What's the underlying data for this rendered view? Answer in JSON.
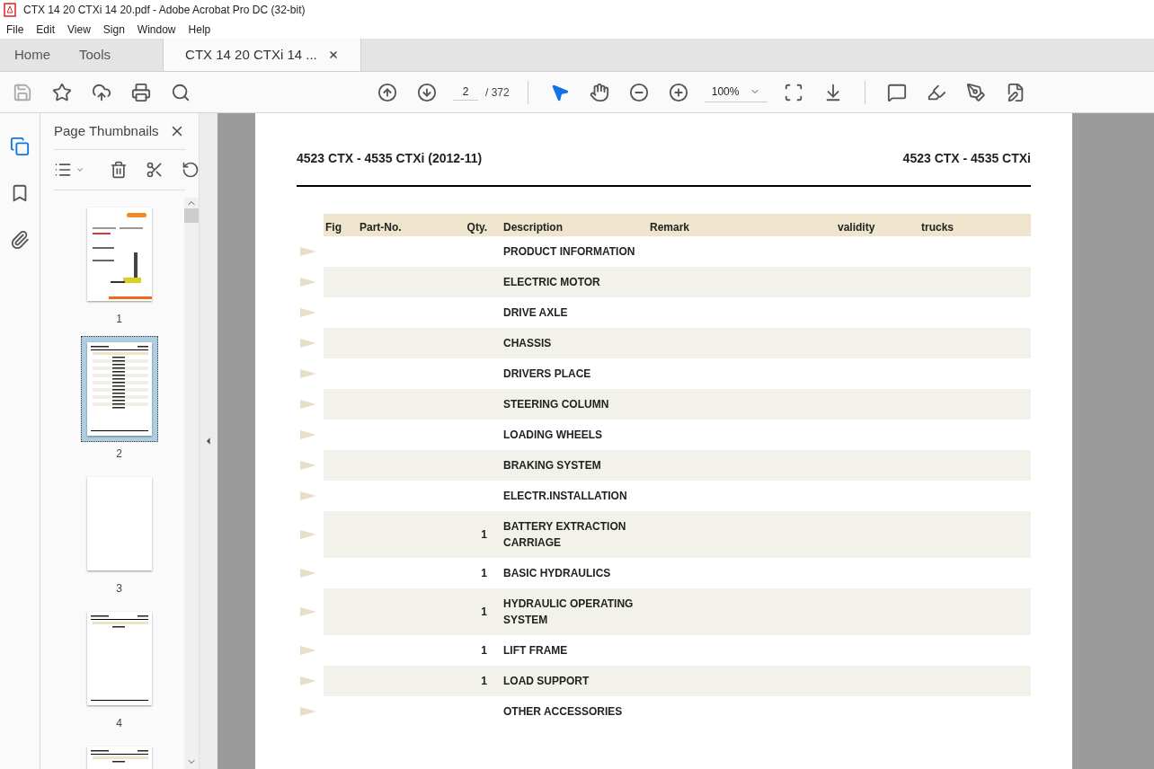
{
  "window": {
    "title": "CTX 14 20 CTXi 14 20.pdf - Adobe Acrobat Pro DC (32-bit)"
  },
  "menu": [
    "File",
    "Edit",
    "View",
    "Sign",
    "Window",
    "Help"
  ],
  "tabs": [
    {
      "label": "Home",
      "selected": false,
      "kind": "nav"
    },
    {
      "label": "Tools",
      "selected": false,
      "kind": "nav"
    },
    {
      "label": "CTX 14 20 CTXi 14 ...",
      "selected": true,
      "kind": "document"
    }
  ],
  "toolbar": {
    "page_field": "2",
    "page_total": "/ 372",
    "zoom": "100%"
  },
  "side_panel": {
    "title": "Page Thumbnails",
    "thumbnails": [
      {
        "label": "1",
        "selected": false,
        "kind": "cover"
      },
      {
        "label": "2",
        "selected": true,
        "kind": "table"
      },
      {
        "label": "3",
        "selected": false,
        "kind": "blank"
      },
      {
        "label": "4",
        "selected": false,
        "kind": "short"
      },
      {
        "kind": "short",
        "selected": false
      }
    ]
  },
  "document": {
    "header_left": "4523 CTX - 4535 CTXi (2012-11)",
    "header_right": "4523 CTX - 4535 CTXi",
    "table": {
      "columns": [
        "Fig",
        "Part-No.",
        "Qty.",
        "Description",
        "Remark",
        "validity",
        "trucks"
      ],
      "rows": [
        {
          "qty": null,
          "description": "PRODUCT INFORMATION"
        },
        {
          "qty": null,
          "description": "ELECTRIC MOTOR"
        },
        {
          "qty": null,
          "description": "DRIVE AXLE"
        },
        {
          "qty": null,
          "description": "CHASSIS"
        },
        {
          "qty": null,
          "description": "DRIVERS PLACE"
        },
        {
          "qty": null,
          "description": "STEERING COLUMN"
        },
        {
          "qty": null,
          "description": "LOADING WHEELS"
        },
        {
          "qty": null,
          "description": "BRAKING SYSTEM"
        },
        {
          "qty": null,
          "description": "ELECTR.INSTALLATION"
        },
        {
          "qty": "1",
          "description": "BATTERY EXTRACTION CARRIAGE"
        },
        {
          "qty": "1",
          "description": "BASIC HYDRAULICS"
        },
        {
          "qty": "1",
          "description": "HYDRAULIC OPERATING SYSTEM"
        },
        {
          "qty": "1",
          "description": "LIFT FRAME"
        },
        {
          "qty": "1",
          "description": "LOAD SUPPORT"
        },
        {
          "qty": null,
          "description": "OTHER ACCESSORIES"
        }
      ]
    }
  }
}
